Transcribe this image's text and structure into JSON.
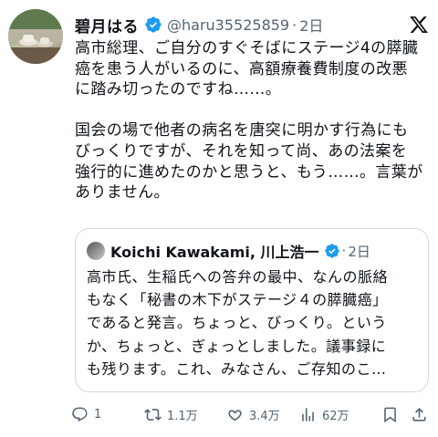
{
  "tweet": {
    "author_name": "碧月はる",
    "handle": "@haru35525859",
    "separator": "·",
    "time": "2日",
    "text": "高市総理、ご自分のすぐそばにステージ4の膵臓\n癌を患う人がいるのに、高額療養費制度の改悪\nに踏み切ったのですね……。\n\n国会の場で他者の病名を唐突に明かす行為にも\nびっくりですが、それを知って尚、あの法案を\n強行的に進めたのかと思うと、もう……。言葉が\nありません。"
  },
  "quote": {
    "author_name": "Koichi Kawakami, 川上浩一",
    "separator": "·",
    "time": "2日",
    "text": "高市氏、生稲氏への答弁の最中、なんの脈絡\nもなく「秘書の木下がステージ４の膵臓癌」\nであると発言。ちょっと、びっくり。という\nか、ちょっと、ぎょっとしました。議事録に\nも残ります。これ、みなさん、ご存知のこ…"
  },
  "actions": {
    "replies": "1",
    "retweets": "1.1万",
    "likes": "3.4万",
    "views": "62万"
  },
  "icons": [
    "verified-badge-icon",
    "x-logo-icon",
    "reply-icon",
    "retweet-icon",
    "like-icon",
    "views-icon",
    "bookmark-icon",
    "share-icon"
  ],
  "colors": {
    "verified": "#1d9bf0",
    "muted": "#536471",
    "text": "#0f1419"
  }
}
